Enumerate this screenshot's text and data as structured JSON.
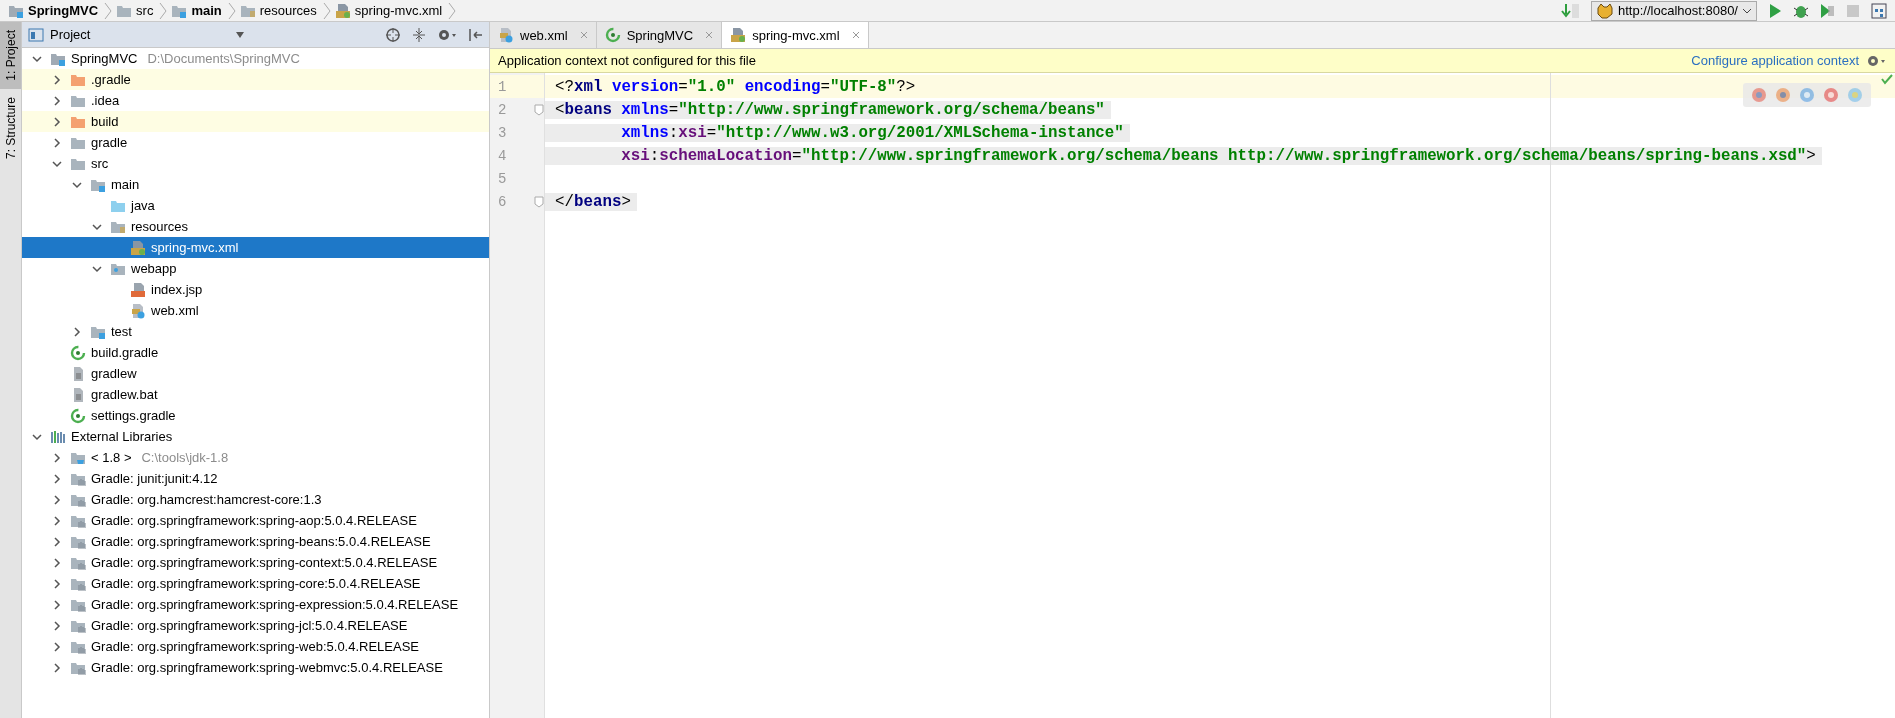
{
  "breadcrumbs": [
    {
      "label": "SpringMVC",
      "kind": "module",
      "bold": true
    },
    {
      "label": "src",
      "kind": "folder",
      "bold": false
    },
    {
      "label": "main",
      "kind": "source-folder",
      "bold": true
    },
    {
      "label": "resources",
      "kind": "resources-folder",
      "bold": false
    },
    {
      "label": "spring-mvc.xml",
      "kind": "xml-spring",
      "bold": false
    }
  ],
  "run_config": {
    "label": "http://localhost:8080/"
  },
  "side_tabs": [
    {
      "label": "1: Project",
      "selected": true
    },
    {
      "label": "7: Structure",
      "selected": false
    }
  ],
  "project_panel": {
    "title": "Project",
    "tree": [
      {
        "label": "SpringMVC",
        "detail": "D:\\Documents\\SpringMVC",
        "kind": "module",
        "expanded": true,
        "selected": false,
        "children": [
          {
            "label": ".gradle",
            "kind": "folder",
            "excluded": true,
            "expanded": false,
            "selected": false
          },
          {
            "label": ".idea",
            "kind": "folder",
            "excluded": false,
            "expanded": false,
            "selected": false
          },
          {
            "label": "build",
            "kind": "folder",
            "excluded": true,
            "expanded": false,
            "selected": false
          },
          {
            "label": "gradle",
            "kind": "folder",
            "excluded": false,
            "expanded": false,
            "selected": false
          },
          {
            "label": "src",
            "kind": "folder",
            "excluded": false,
            "expanded": true,
            "selected": false,
            "children": [
              {
                "label": "main",
                "kind": "source-folder",
                "expanded": true,
                "selected": false,
                "children": [
                  {
                    "label": "java",
                    "kind": "java-folder",
                    "selected": false
                  },
                  {
                    "label": "resources",
                    "kind": "resources-folder",
                    "expanded": true,
                    "selected": false,
                    "children": [
                      {
                        "label": "spring-mvc.xml",
                        "kind": "xml-spring",
                        "selected": true
                      }
                    ]
                  },
                  {
                    "label": "webapp",
                    "kind": "web-folder",
                    "expanded": true,
                    "selected": false,
                    "children": [
                      {
                        "label": "index.jsp",
                        "kind": "jsp",
                        "selected": false
                      },
                      {
                        "label": "web.xml",
                        "kind": "web-xml",
                        "selected": false
                      }
                    ]
                  }
                ]
              },
              {
                "label": "test",
                "kind": "source-folder",
                "expanded": false,
                "selected": false
              }
            ]
          },
          {
            "label": "build.gradle",
            "kind": "gradle",
            "selected": false
          },
          {
            "label": "gradlew",
            "kind": "script",
            "selected": false
          },
          {
            "label": "gradlew.bat",
            "kind": "script",
            "selected": false
          },
          {
            "label": "settings.gradle",
            "kind": "gradle",
            "selected": false
          }
        ]
      },
      {
        "label": "External Libraries",
        "kind": "libraries",
        "expanded": true,
        "selected": false,
        "children": [
          {
            "label": "< 1.8 >",
            "detail": "C:\\tools\\jdk-1.8",
            "kind": "jdk",
            "expanded": false,
            "selected": false
          },
          {
            "label": "Gradle: junit:junit:4.12",
            "kind": "library",
            "expanded": false,
            "selected": false
          },
          {
            "label": "Gradle: org.hamcrest:hamcrest-core:1.3",
            "kind": "library",
            "expanded": false,
            "selected": false
          },
          {
            "label": "Gradle: org.springframework:spring-aop:5.0.4.RELEASE",
            "kind": "library",
            "expanded": false,
            "selected": false
          },
          {
            "label": "Gradle: org.springframework:spring-beans:5.0.4.RELEASE",
            "kind": "library",
            "expanded": false,
            "selected": false
          },
          {
            "label": "Gradle: org.springframework:spring-context:5.0.4.RELEASE",
            "kind": "library",
            "expanded": false,
            "selected": false
          },
          {
            "label": "Gradle: org.springframework:spring-core:5.0.4.RELEASE",
            "kind": "library",
            "expanded": false,
            "selected": false
          },
          {
            "label": "Gradle: org.springframework:spring-expression:5.0.4.RELEASE",
            "kind": "library",
            "expanded": false,
            "selected": false
          },
          {
            "label": "Gradle: org.springframework:spring-jcl:5.0.4.RELEASE",
            "kind": "library",
            "expanded": false,
            "selected": false
          },
          {
            "label": "Gradle: org.springframework:spring-web:5.0.4.RELEASE",
            "kind": "library",
            "expanded": false,
            "selected": false
          },
          {
            "label": "Gradle: org.springframework:spring-webmvc:5.0.4.RELEASE",
            "kind": "library",
            "expanded": false,
            "selected": false
          }
        ]
      }
    ]
  },
  "editor_tabs": [
    {
      "label": "web.xml",
      "kind": "web-xml",
      "selected": false
    },
    {
      "label": "SpringMVC",
      "kind": "gradle",
      "selected": false
    },
    {
      "label": "spring-mvc.xml",
      "kind": "xml-spring",
      "selected": true
    }
  ],
  "banner": {
    "message": "Application context not configured for this file",
    "link": "Configure application context"
  },
  "editor": {
    "lines": [
      {
        "number": "1",
        "current": true,
        "fold": false,
        "tag_scope": false,
        "tokens": [
          {
            "kind": "punct",
            "text": "<?"
          },
          {
            "kind": "tag",
            "text": "xml"
          },
          {
            "kind": "attr",
            "text": " version"
          },
          {
            "kind": "punct",
            "text": "="
          },
          {
            "kind": "value",
            "text": "\"1.0\""
          },
          {
            "kind": "attr",
            "text": " encoding"
          },
          {
            "kind": "punct",
            "text": "="
          },
          {
            "kind": "value",
            "text": "\"UTF-8\""
          },
          {
            "kind": "punct",
            "text": "?>"
          }
        ]
      },
      {
        "number": "2",
        "current": false,
        "fold": true,
        "tag_scope": true,
        "tokens": [
          {
            "kind": "punct",
            "text": "<"
          },
          {
            "kind": "tag",
            "text": "beans"
          },
          {
            "kind": "attr",
            "text": " xmlns"
          },
          {
            "kind": "punct",
            "text": "="
          },
          {
            "kind": "value",
            "text": "\"http://www.springframework.org/schema/beans\""
          }
        ]
      },
      {
        "number": "3",
        "current": false,
        "fold": false,
        "tag_scope": true,
        "tokens": [
          {
            "kind": "attr",
            "text": "       xmlns"
          },
          {
            "kind": "punct",
            "text": ":"
          },
          {
            "kind": "ns",
            "text": "xsi"
          },
          {
            "kind": "punct",
            "text": "="
          },
          {
            "kind": "value",
            "text": "\"http://www.w3.org/2001/XMLSchema-instance\""
          }
        ]
      },
      {
        "number": "4",
        "current": false,
        "fold": false,
        "tag_scope": true,
        "tokens": [
          {
            "kind": "ns",
            "text": "       xsi"
          },
          {
            "kind": "punct",
            "text": ":"
          },
          {
            "kind": "ns",
            "text": "schemaLocation"
          },
          {
            "kind": "punct",
            "text": "="
          },
          {
            "kind": "value",
            "text": "\"http://www.springframework.org/schema/beans http://www.springframework.org/schema/beans/spring-beans.xsd\""
          },
          {
            "kind": "punct",
            "text": ">"
          }
        ]
      },
      {
        "number": "5",
        "current": false,
        "fold": false
      },
      {
        "number": "6",
        "current": false,
        "fold": true,
        "tag_scope": true,
        "tokens": [
          {
            "kind": "punct",
            "text": "</"
          },
          {
            "kind": "tag",
            "text": "beans"
          },
          {
            "kind": "punct",
            "text": ">"
          }
        ]
      }
    ]
  }
}
